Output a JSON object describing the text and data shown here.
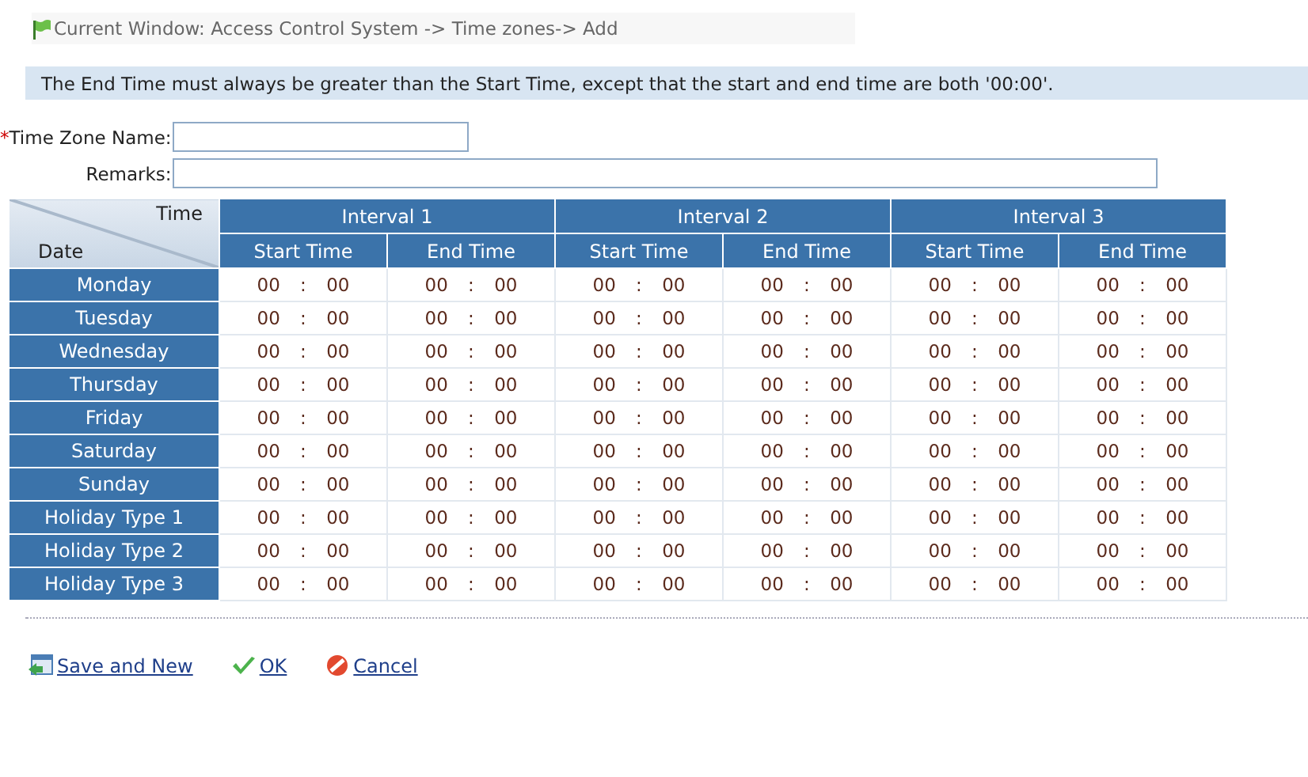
{
  "breadcrumb": "Current Window: Access Control System -> Time zones-> Add",
  "notice": "The End Time must always be greater than the Start Time, except that the start and end time are both '00:00'.",
  "fields": [
    {
      "label": "Time Zone Name:",
      "required_mark": "*",
      "kind": "short"
    },
    {
      "label": "Remarks:",
      "kind": "long"
    }
  ],
  "table": {
    "corner_top": "Time",
    "corner_bottom": "Date",
    "intervals": [
      {
        "title": "Interval 1",
        "columns": [
          "Start Time",
          "End Time"
        ]
      },
      {
        "title": "Interval 2",
        "columns": [
          "Start Time",
          "End Time"
        ]
      },
      {
        "title": "Interval 3",
        "columns": [
          "Start Time",
          "End Time"
        ]
      }
    ],
    "rows": [
      {
        "day": "Monday",
        "times": [
          "00 : 00",
          "00 : 00",
          "00 : 00",
          "00 : 00",
          "00 : 00",
          "00 : 00"
        ]
      },
      {
        "day": "Tuesday",
        "times": [
          "00 : 00",
          "00 : 00",
          "00 : 00",
          "00 : 00",
          "00 : 00",
          "00 : 00"
        ]
      },
      {
        "day": "Wednesday",
        "times": [
          "00 : 00",
          "00 : 00",
          "00 : 00",
          "00 : 00",
          "00 : 00",
          "00 : 00"
        ]
      },
      {
        "day": "Thursday",
        "times": [
          "00 : 00",
          "00 : 00",
          "00 : 00",
          "00 : 00",
          "00 : 00",
          "00 : 00"
        ]
      },
      {
        "day": "Friday",
        "times": [
          "00 : 00",
          "00 : 00",
          "00 : 00",
          "00 : 00",
          "00 : 00",
          "00 : 00"
        ]
      },
      {
        "day": "Saturday",
        "times": [
          "00 : 00",
          "00 : 00",
          "00 : 00",
          "00 : 00",
          "00 : 00",
          "00 : 00"
        ]
      },
      {
        "day": "Sunday",
        "times": [
          "00 : 00",
          "00 : 00",
          "00 : 00",
          "00 : 00",
          "00 : 00",
          "00 : 00"
        ]
      },
      {
        "day": "Holiday Type 1",
        "times": [
          "00 : 00",
          "00 : 00",
          "00 : 00",
          "00 : 00",
          "00 : 00",
          "00 : 00"
        ]
      },
      {
        "day": "Holiday Type 2",
        "times": [
          "00 : 00",
          "00 : 00",
          "00 : 00",
          "00 : 00",
          "00 : 00",
          "00 : 00"
        ]
      },
      {
        "day": "Holiday Type 3",
        "times": [
          "00 : 00",
          "00 : 00",
          "00 : 00",
          "00 : 00",
          "00 : 00",
          "00 : 00"
        ]
      }
    ]
  },
  "actions": [
    {
      "label": "Save and New",
      "kind": "save"
    },
    {
      "label": "OK",
      "kind": "ok"
    },
    {
      "label": "Cancel",
      "kind": "cancel"
    }
  ]
}
